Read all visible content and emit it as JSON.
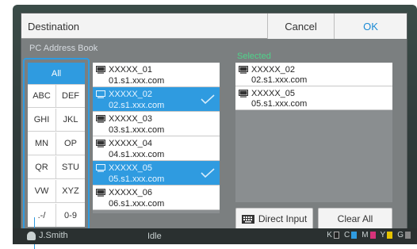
{
  "dialog": {
    "title": "Destination",
    "cancel_label": "Cancel",
    "ok_label": "OK"
  },
  "address_book": {
    "label": "PC Address Book",
    "entries": [
      {
        "name": "XXXXX_01",
        "address": "01.s1.xxx.com",
        "selected": false
      },
      {
        "name": "XXXXX_02",
        "address": "02.s1.xxx.com",
        "selected": true
      },
      {
        "name": "XXXXX_03",
        "address": "03.s1.xxx.com",
        "selected": false
      },
      {
        "name": "XXXXX_04",
        "address": "04.s1.xxx.com",
        "selected": false
      },
      {
        "name": "XXXXX_05",
        "address": "05.s1.xxx.com",
        "selected": true
      },
      {
        "name": "XXXXX_06",
        "address": "06.s1.xxx.com",
        "selected": false
      }
    ]
  },
  "index_keys": {
    "all": "All",
    "rows": [
      [
        "ABC",
        "DEF"
      ],
      [
        "GHI",
        "JKL"
      ],
      [
        "MN",
        "OP"
      ],
      [
        "QR",
        "STU"
      ],
      [
        "VW",
        "XYZ"
      ],
      [
        ".-/",
        "0-9"
      ]
    ]
  },
  "selected_panel": {
    "label": "Selected",
    "items": [
      {
        "name": "XXXXX_02",
        "address": "02.s1.xxx.com"
      },
      {
        "name": "XXXXX_05",
        "address": "05.s1.xxx.com"
      }
    ]
  },
  "actions": {
    "direct_input_label": "Direct Input",
    "clear_all_label": "Clear All"
  },
  "status_bar": {
    "user": "J.Smith",
    "state": "Idle",
    "inks": [
      "K",
      "C",
      "M",
      "Y",
      "G"
    ]
  },
  "colors": {
    "accent": "#2f9be0",
    "selected_label": "#4fd38a",
    "ok_text": "#1a8ad4",
    "ink_k": "#222222",
    "ink_c": "#2f9be0",
    "ink_m": "#d6337a",
    "ink_y": "#e6c300",
    "ink_g": "#888888"
  },
  "icons": {
    "entry": "pc-monitor-icon",
    "check": "checkmark-icon",
    "direct_input": "keyboard-icon",
    "user": "user-icon"
  }
}
